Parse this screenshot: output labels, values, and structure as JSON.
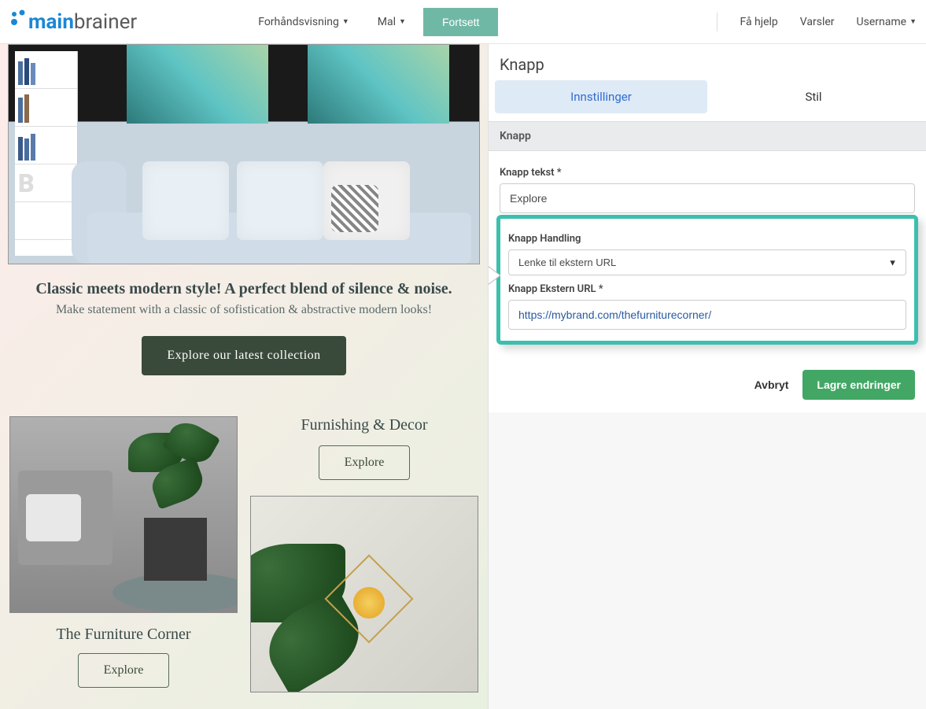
{
  "logo": {
    "main": "main",
    "sub": "brainer"
  },
  "nav": {
    "preview": "Forhåndsvisning",
    "template": "Mal",
    "continue": "Fortsett",
    "help": "Få hjelp",
    "alerts": "Varsler",
    "user": "Username"
  },
  "preview": {
    "hero_title": "Classic meets modern style! A perfect blend of silence & noise.",
    "hero_sub": "Make statement with a classic of sofistication & abstractive modern looks!",
    "hero_button": "Explore our latest collection",
    "card1_title": "The Furniture Corner",
    "card1_button": "Explore",
    "card2_title": "Furnishing & Decor",
    "card2_button": "Explore"
  },
  "panel": {
    "title": "Knapp",
    "tab_settings": "Innstillinger",
    "tab_style": "Stil",
    "section": "Knapp",
    "label_text": "Knapp tekst",
    "value_text": "Explore",
    "label_action": "Knapp Handling",
    "value_action": "Lenke til ekstern URL",
    "label_url": "Knapp Ekstern URL",
    "value_url": "https://mybrand.com/thefurniturecorner/",
    "cancel": "Avbryt",
    "save": "Lagre endringer"
  }
}
